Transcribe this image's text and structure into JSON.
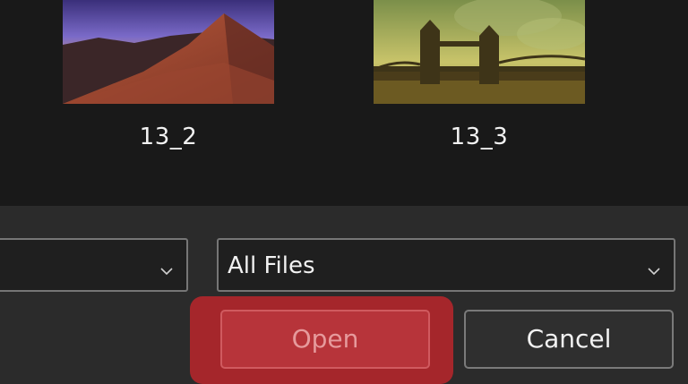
{
  "files": [
    {
      "name": "13_2",
      "thumbnail": "desert-dune-image"
    },
    {
      "name": "13_3",
      "thumbnail": "tower-bridge-image"
    }
  ],
  "footer": {
    "file_name_value": "",
    "file_type_value": "All Files",
    "open_label": "Open",
    "cancel_label": "Cancel"
  },
  "colors": {
    "accent_highlight": "#a5262b",
    "open_button_bg": "#b7343a",
    "panel_bg": "#2b2b2b",
    "grid_bg": "#191919"
  },
  "icons": {
    "dropdown": "chevron-down-icon"
  }
}
